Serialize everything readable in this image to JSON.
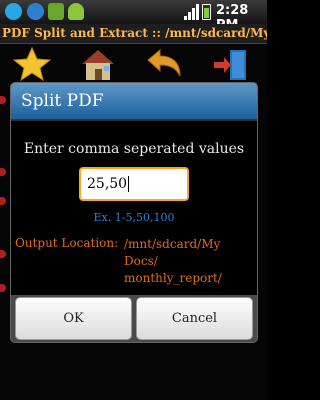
{
  "status_bar": {
    "time": "2:28 PM",
    "icons": [
      "skype-icon",
      "sync-icon",
      "sd-card-icon",
      "android-icon",
      "wifi-icon",
      "signal-icon",
      "battery-icon"
    ]
  },
  "app": {
    "title": "PDF Split and Extract :: /mnt/sdcard/My Docs"
  },
  "toolbar": {
    "icons": [
      "star-icon",
      "home-icon",
      "back-arrow-icon",
      "exit-door-icon"
    ]
  },
  "dialog": {
    "title": "Split PDF",
    "prompt": "Enter comma seperated values",
    "input_value": "25,50",
    "example": "Ex. 1-5,50,100",
    "output_label": "Output Location:",
    "output_value": "/mnt/sdcard/My Docs/ monthly_report/",
    "ok_label": "OK",
    "cancel_label": "Cancel"
  },
  "colors": {
    "title_text": "#ffb84d",
    "dialog_header": "#1d5f9c",
    "input_border": "#f5a623",
    "example_text": "#2f7fd3",
    "output_text": "#e46a1f"
  }
}
